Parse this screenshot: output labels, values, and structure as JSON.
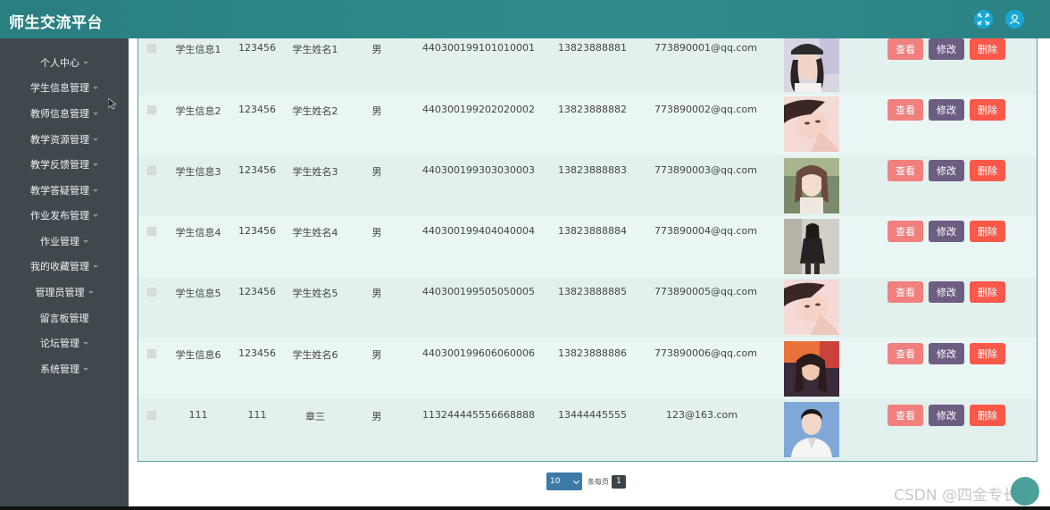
{
  "app": {
    "title": "师生交流平台"
  },
  "topbar": {
    "icons": [
      "fullscreen-icon",
      "user-icon"
    ]
  },
  "sidebar": {
    "items": [
      {
        "label": "个人中心",
        "caret": true
      },
      {
        "label": "学生信息管理",
        "caret": true
      },
      {
        "label": "教师信息管理",
        "caret": true
      },
      {
        "label": "教学资源管理",
        "caret": true
      },
      {
        "label": "教学反馈管理",
        "caret": true
      },
      {
        "label": "教学答疑管理",
        "caret": true
      },
      {
        "label": "作业发布管理",
        "caret": true
      },
      {
        "label": "作业管理",
        "caret": true
      },
      {
        "label": "我的收藏管理",
        "caret": true
      },
      {
        "label": "管理员管理",
        "caret": true
      },
      {
        "label": "留言板管理",
        "caret": false
      },
      {
        "label": "论坛管理",
        "caret": true
      },
      {
        "label": "系统管理",
        "caret": true
      }
    ]
  },
  "table": {
    "rows": [
      {
        "info": "学生信息1",
        "password": "123456",
        "name": "学生姓名1",
        "gender": "男",
        "id_card": "440300199101010001",
        "phone": "13823888881",
        "email": "773890001@qq.com",
        "photo": "photo-cap-girl"
      },
      {
        "info": "学生信息2",
        "password": "123456",
        "name": "学生姓名2",
        "gender": "男",
        "id_card": "440300199202020002",
        "phone": "13823888882",
        "email": "773890002@qq.com",
        "photo": "photo-lying-girl"
      },
      {
        "info": "学生信息3",
        "password": "123456",
        "name": "学生姓名3",
        "gender": "男",
        "id_card": "440300199303030003",
        "phone": "13823888883",
        "email": "773890003@qq.com",
        "photo": "photo-smile-girl"
      },
      {
        "info": "学生信息4",
        "password": "123456",
        "name": "学生姓名4",
        "gender": "男",
        "id_card": "440300199404040004",
        "phone": "13823888884",
        "email": "773890004@qq.com",
        "photo": "photo-standing-girl"
      },
      {
        "info": "学生信息5",
        "password": "123456",
        "name": "学生姓名5",
        "gender": "男",
        "id_card": "440300199505050005",
        "phone": "13823888885",
        "email": "773890005@qq.com",
        "photo": "photo-lying-girl"
      },
      {
        "info": "学生信息6",
        "password": "123456",
        "name": "学生姓名6",
        "gender": "男",
        "id_card": "440300199606060006",
        "phone": "13823888886",
        "email": "773890006@qq.com",
        "photo": "photo-night-girl"
      },
      {
        "info": "111",
        "password": "111",
        "name": "章三",
        "gender": "男",
        "id_card": "113244445556668888",
        "phone": "13444445555",
        "email": "123@163.com",
        "photo": "photo-young-man"
      }
    ],
    "buttons": {
      "view": "查看",
      "edit": "修改",
      "delete": "删除"
    }
  },
  "pagination": {
    "page_size": "10",
    "per_page_label": "条每页",
    "current_page": "1"
  },
  "watermark": "CSDN @四金专长",
  "colors": {
    "accent": "#2f8b8c",
    "sidebar_bg": "#3f484c",
    "view_btn": "#f07f7d",
    "edit_btn": "#6d5d82",
    "delete_btn": "#fa5849"
  }
}
